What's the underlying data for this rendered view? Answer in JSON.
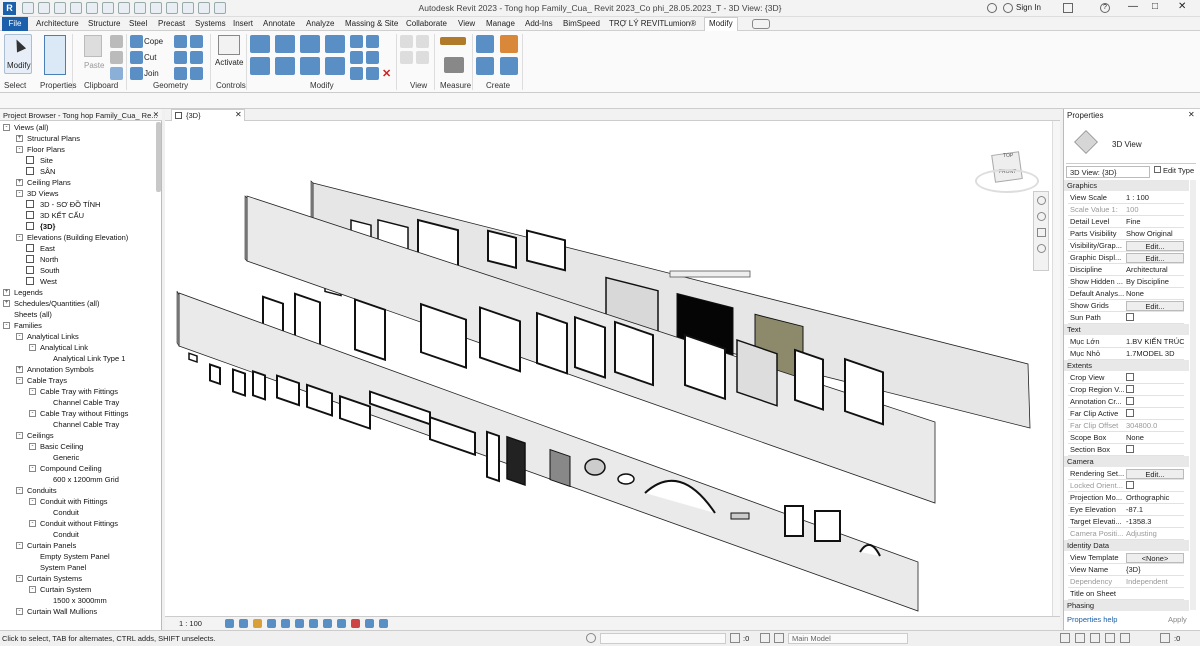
{
  "titlebar": {
    "title": "Autodesk Revit 2023 - Tong hop Family_Cua_ Revit 2023_Co phi_28.05.2023_T - 3D View: {3D}",
    "signin": "Sign In"
  },
  "ribbon_tabs": [
    {
      "label": "File"
    },
    {
      "label": "Architecture"
    },
    {
      "label": "Structure"
    },
    {
      "label": "Steel"
    },
    {
      "label": "Precast"
    },
    {
      "label": "Systems"
    },
    {
      "label": "Insert"
    },
    {
      "label": "Annotate"
    },
    {
      "label": "Analyze"
    },
    {
      "label": "Massing & Site"
    },
    {
      "label": "Collaborate"
    },
    {
      "label": "View"
    },
    {
      "label": "Manage"
    },
    {
      "label": "Add-Ins"
    },
    {
      "label": "BimSpeed"
    },
    {
      "label": "TRỢ LÝ REVIT"
    },
    {
      "label": "Lumion®"
    },
    {
      "label": "Modify"
    }
  ],
  "ribbon": {
    "modify_label": "Modify",
    "paste_label": "Paste",
    "cope_label": "Cope",
    "cut_label": "Cut",
    "join_label": "Join",
    "activate_label": "Activate",
    "panels": {
      "select": "Select",
      "properties": "Properties",
      "clipboard": "Clipboard",
      "geometry": "Geometry",
      "controls": "Controls",
      "modify": "Modify",
      "view": "View",
      "measure": "Measure",
      "create": "Create"
    }
  },
  "project_browser": {
    "header": "Project Browser - Tong hop Family_Cua_ Re...",
    "items": [
      {
        "label": "Views (all)",
        "level": 0,
        "box": "-"
      },
      {
        "label": "Structural Plans",
        "level": 1,
        "box": "+"
      },
      {
        "label": "Floor Plans",
        "level": 1,
        "box": "-"
      },
      {
        "label": "Site",
        "level": 2,
        "view": true
      },
      {
        "label": "SÂN",
        "level": 2,
        "view": true
      },
      {
        "label": "Ceiling Plans",
        "level": 1,
        "box": "+"
      },
      {
        "label": "3D Views",
        "level": 1,
        "box": "-"
      },
      {
        "label": "3D - SƠ ĐỒ TÍNH",
        "level": 2,
        "view": true
      },
      {
        "label": "3D KẾT CẤU",
        "level": 2,
        "view": true
      },
      {
        "label": "{3D}",
        "level": 2,
        "view": true,
        "bold": true
      },
      {
        "label": "Elevations (Building Elevation)",
        "level": 1,
        "box": "-"
      },
      {
        "label": "East",
        "level": 2,
        "view": true
      },
      {
        "label": "North",
        "level": 2,
        "view": true
      },
      {
        "label": "South",
        "level": 2,
        "view": true
      },
      {
        "label": "West",
        "level": 2,
        "view": true
      },
      {
        "label": "Legends",
        "level": 0,
        "box": "+"
      },
      {
        "label": "Schedules/Quantities (all)",
        "level": 0,
        "box": "+"
      },
      {
        "label": "Sheets (all)",
        "level": 0,
        "box": ""
      },
      {
        "label": "Families",
        "level": 0,
        "box": "-"
      },
      {
        "label": "Analytical Links",
        "level": 1,
        "box": "-"
      },
      {
        "label": "Analytical Link",
        "level": 2,
        "box": "-"
      },
      {
        "label": "Analytical Link Type 1",
        "level": 3
      },
      {
        "label": "Annotation Symbols",
        "level": 1,
        "box": "+"
      },
      {
        "label": "Cable Trays",
        "level": 1,
        "box": "-"
      },
      {
        "label": "Cable Tray with Fittings",
        "level": 2,
        "box": "-"
      },
      {
        "label": "Channel Cable Tray",
        "level": 3
      },
      {
        "label": "Cable Tray without Fittings",
        "level": 2,
        "box": "-"
      },
      {
        "label": "Channel Cable Tray",
        "level": 3
      },
      {
        "label": "Ceilings",
        "level": 1,
        "box": "-"
      },
      {
        "label": "Basic Ceiling",
        "level": 2,
        "box": "-"
      },
      {
        "label": "Generic",
        "level": 3
      },
      {
        "label": "Compound Ceiling",
        "level": 2,
        "box": "-"
      },
      {
        "label": "600 x 1200mm Grid",
        "level": 3
      },
      {
        "label": "Conduits",
        "level": 1,
        "box": "-"
      },
      {
        "label": "Conduit with Fittings",
        "level": 2,
        "box": "-"
      },
      {
        "label": "Conduit",
        "level": 3
      },
      {
        "label": "Conduit without Fittings",
        "level": 2,
        "box": "-"
      },
      {
        "label": "Conduit",
        "level": 3
      },
      {
        "label": "Curtain Panels",
        "level": 1,
        "box": "-"
      },
      {
        "label": "Empty System Panel",
        "level": 2
      },
      {
        "label": "System Panel",
        "level": 2
      },
      {
        "label": "Curtain Systems",
        "level": 1,
        "box": "-"
      },
      {
        "label": "Curtain System",
        "level": 2,
        "box": "-"
      },
      {
        "label": "1500 x 3000mm",
        "level": 3
      },
      {
        "label": "Curtain Wall Mullions",
        "level": 1,
        "box": "-"
      }
    ]
  },
  "view": {
    "tab_label": "{3D}",
    "scale": "1 : 100",
    "cube_top": "TOP",
    "cube_front": "FRONT"
  },
  "properties": {
    "header": "Properties",
    "type_name": "3D View",
    "selector": "3D View: {3D}",
    "edit_type": "Edit Type",
    "rows": [
      {
        "group": "Graphics"
      },
      {
        "k": "View Scale",
        "v": "1 : 100"
      },
      {
        "k": "Scale Value    1:",
        "v": "100",
        "grey": true
      },
      {
        "k": "Detail Level",
        "v": "Fine"
      },
      {
        "k": "Parts Visibility",
        "v": "Show Original"
      },
      {
        "k": "Visibility/Grap...",
        "v": "Edit...",
        "btn": true
      },
      {
        "k": "Graphic Displ...",
        "v": "Edit...",
        "btn": true
      },
      {
        "k": "Discipline",
        "v": "Architectural"
      },
      {
        "k": "Show Hidden ...",
        "v": "By Discipline"
      },
      {
        "k": "Default Analys...",
        "v": "None"
      },
      {
        "k": "Show Grids",
        "v": "Edit...",
        "btn": true
      },
      {
        "k": "Sun Path",
        "v": "",
        "chk": true
      },
      {
        "group": "Text"
      },
      {
        "k": "Mục Lớn",
        "v": "1.BV KIẾN TRÚC"
      },
      {
        "k": "Mục Nhỏ",
        "v": "1.7MODEL 3D"
      },
      {
        "group": "Extents"
      },
      {
        "k": "Crop View",
        "v": "",
        "chk": true
      },
      {
        "k": "Crop Region V...",
        "v": "",
        "chk": true
      },
      {
        "k": "Annotation Cr...",
        "v": "",
        "chk": true
      },
      {
        "k": "Far Clip Active",
        "v": "",
        "chk": true
      },
      {
        "k": "Far Clip Offset",
        "v": "304800.0",
        "grey": true
      },
      {
        "k": "Scope Box",
        "v": "None"
      },
      {
        "k": "Section Box",
        "v": "",
        "chk": true
      },
      {
        "group": "Camera"
      },
      {
        "k": "Rendering Set...",
        "v": "Edit...",
        "btn": true
      },
      {
        "k": "Locked Orient...",
        "v": "",
        "chk": true,
        "grey": true
      },
      {
        "k": "Projection Mo...",
        "v": "Orthographic"
      },
      {
        "k": "Eye Elevation",
        "v": "-87.1"
      },
      {
        "k": "Target Elevati...",
        "v": "-1358.3"
      },
      {
        "k": "Camera Positi...",
        "v": "Adjusting",
        "grey": true
      },
      {
        "group": "Identity Data"
      },
      {
        "k": "View Template",
        "v": "<None>",
        "btn": true
      },
      {
        "k": "View Name",
        "v": "{3D}"
      },
      {
        "k": "Dependency",
        "v": "Independent",
        "grey": true
      },
      {
        "k": "Title on Sheet",
        "v": ""
      },
      {
        "group": "Phasing"
      }
    ],
    "help": "Properties help",
    "apply": "Apply"
  },
  "status": {
    "message": "Click to select, TAB for alternates, CTRL adds, SHIFT unselects.",
    "worksets_value": ":0",
    "model": "Main Model"
  }
}
